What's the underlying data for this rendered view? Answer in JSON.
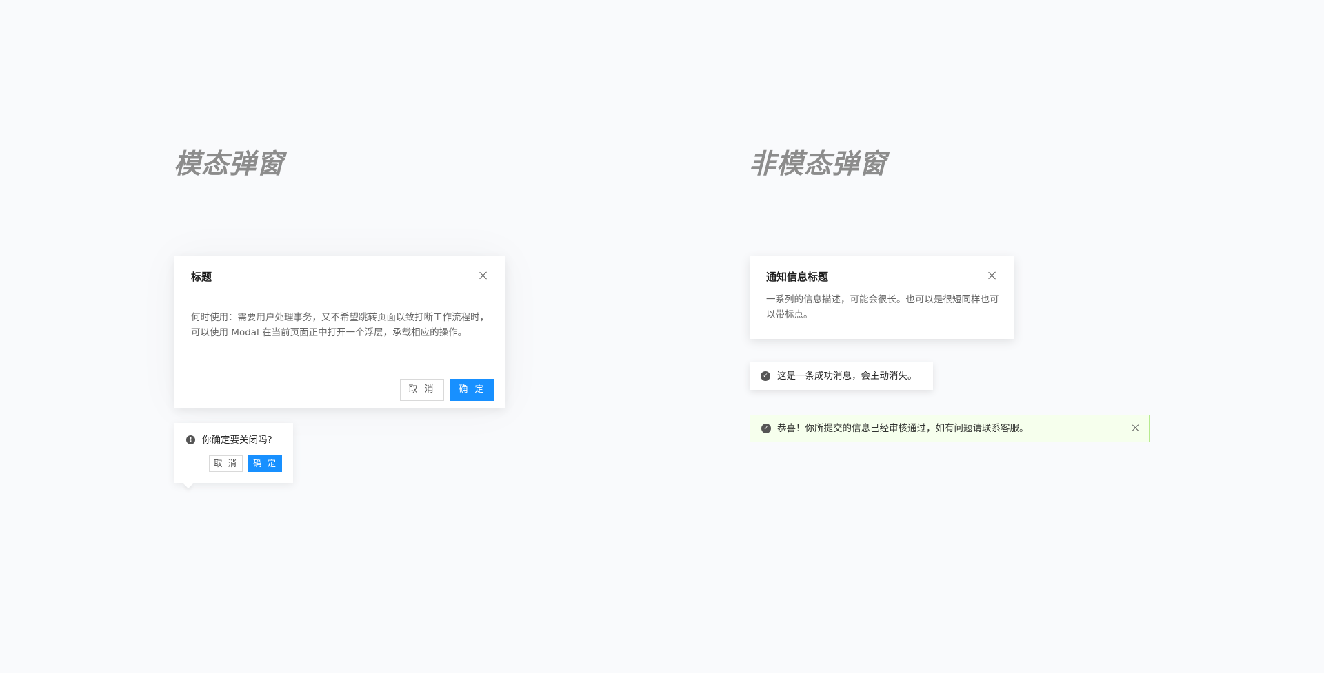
{
  "sections": {
    "modal_heading": "模态弹窗",
    "nonmodal_heading": "非模态弹窗"
  },
  "modal": {
    "title": "标题",
    "body": "何时使用：需要用户处理事务，又不希望跳转页面以致打断工作流程时，可以使用 Modal 在当前页面正中打开一个浮层，承载相应的操作。",
    "cancel_label": "取 消",
    "ok_label": "确 定",
    "close_icon": "close-icon"
  },
  "popconfirm": {
    "message": "你确定要关闭吗?",
    "cancel_label": "取 消",
    "ok_label": "确 定",
    "icon": "exclamation-circle-icon",
    "icon_glyph": "!"
  },
  "notification": {
    "title": "通知信息标题",
    "description": "一系列的信息描述，可能会很长。也可以是很短同样也可以带标点。",
    "close_icon": "close-icon"
  },
  "message": {
    "text": "这是一条成功消息，会主动消失。",
    "icon": "check-circle-icon",
    "icon_glyph": "✓"
  },
  "alert": {
    "text": "恭喜！你所提交的信息已经审核通过，如有问题请联系客服。",
    "icon": "check-circle-icon",
    "icon_glyph": "✓",
    "close_icon": "close-icon",
    "background": "#f6ffed",
    "border": "#b7eb8f"
  },
  "colors": {
    "primary": "#1890ff",
    "page_background": "#f9fafc",
    "heading": "#8c8c8c"
  }
}
